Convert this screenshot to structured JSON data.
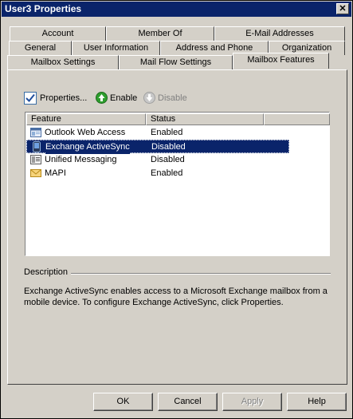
{
  "window": {
    "title": "User3 Properties",
    "close_glyph": "✕"
  },
  "tabs": {
    "row1": [
      "Account",
      "Member Of",
      "E-Mail Addresses"
    ],
    "row2": [
      "General",
      "User Information",
      "Address and Phone",
      "Organization"
    ],
    "row3": [
      "Mailbox Settings",
      "Mail Flow Settings",
      "Mailbox Features"
    ],
    "active": "Mailbox Features"
  },
  "toolbar": {
    "properties_label": "Properties...",
    "enable_label": "Enable",
    "disable_label": "Disable"
  },
  "list": {
    "columns": [
      "Feature",
      "Status"
    ],
    "rows": [
      {
        "feature": "Outlook Web Access",
        "status": "Enabled",
        "icon": "outlook-web-access-icon"
      },
      {
        "feature": "Exchange ActiveSync",
        "status": "Disabled",
        "icon": "mobile-device-icon"
      },
      {
        "feature": "Unified Messaging",
        "status": "Disabled",
        "icon": "unified-messaging-icon"
      },
      {
        "feature": "MAPI",
        "status": "Enabled",
        "icon": "mapi-envelope-icon"
      }
    ],
    "selected_index": 1
  },
  "description": {
    "label": "Description",
    "line1": "Exchange ActiveSync enables access to a Microsoft Exchange mailbox from a",
    "line2": "mobile device. To configure Exchange ActiveSync, click Properties."
  },
  "buttons": {
    "ok": "OK",
    "cancel": "Cancel",
    "apply": "Apply",
    "help": "Help"
  },
  "colors": {
    "selection": "#0a246a",
    "enable_green": "#2e9e2e",
    "dialog_face": "#d4d0c8"
  }
}
